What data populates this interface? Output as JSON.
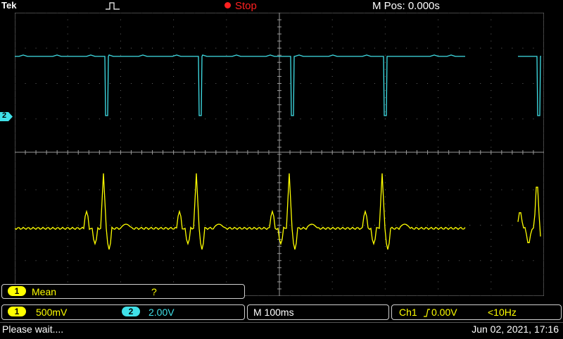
{
  "header": {
    "brand": "Tek",
    "acquisition_state": "Stop",
    "horizontal_position": "M Pos: 0.000s"
  },
  "channel2_marker": "2",
  "measurement": {
    "channel": "1",
    "type": "Mean",
    "value": "?"
  },
  "settings": {
    "ch1_label": "1",
    "ch1_scale": "500mV",
    "ch2_label": "2",
    "ch2_scale": "2.00V"
  },
  "timebase": "M 100ms",
  "trigger": {
    "source_text": "Ch1",
    "level": "0.00V",
    "frequency": "<10Hz"
  },
  "status": {
    "message": "Please wait....",
    "datetime": "Jun 02, 2021, 17:16"
  },
  "colors": {
    "ch1": "#ffff00",
    "ch2": "#40e0e8",
    "stop": "#ff2020"
  }
}
